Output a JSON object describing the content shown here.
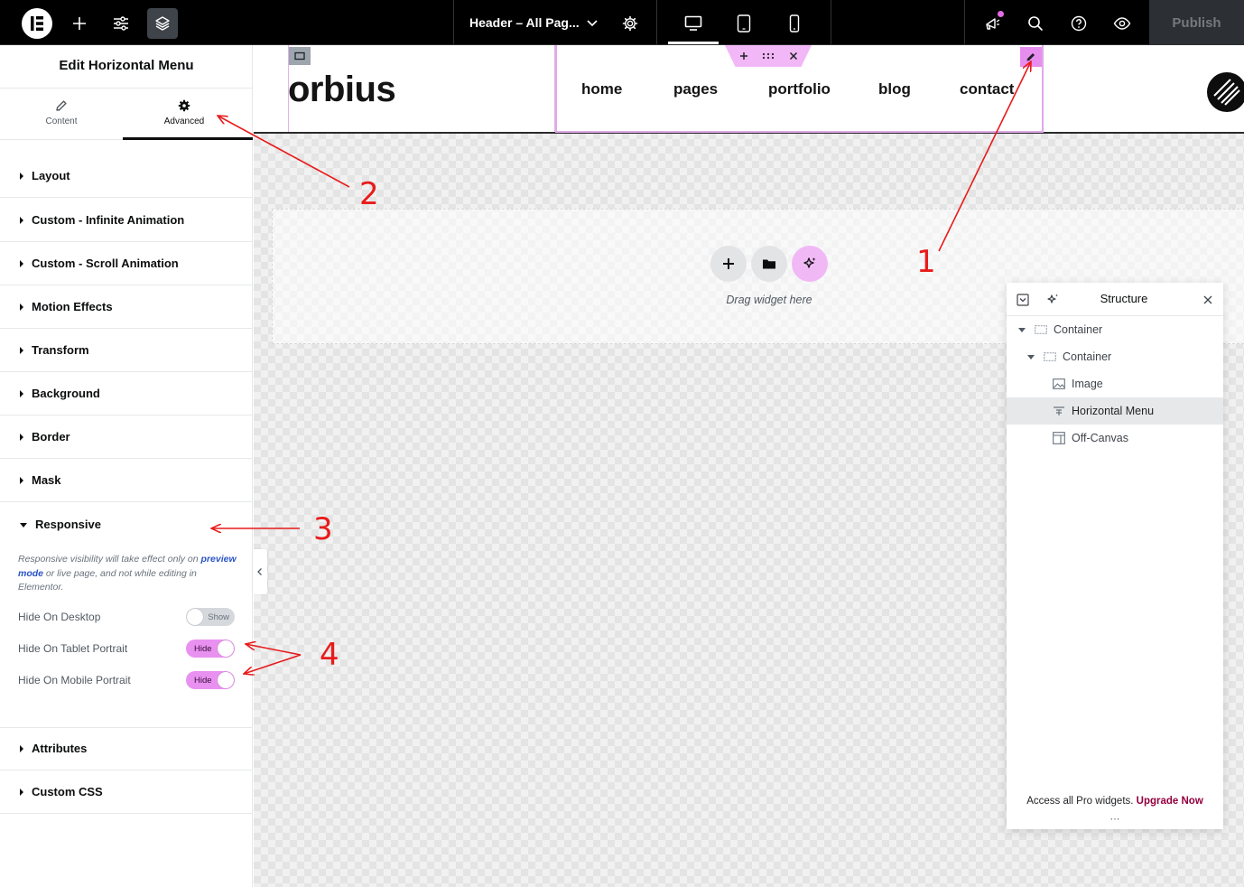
{
  "topbar": {
    "document_title": "Header – All Pag...",
    "publish_label": "Publish",
    "icons": [
      "elementor-logo-icon",
      "plus-icon",
      "sliders-icon",
      "layers-icon",
      "chevron-down-icon",
      "gear-icon",
      "desktop-icon",
      "tablet-icon",
      "mobile-icon",
      "megaphone-icon",
      "search-icon",
      "help-icon",
      "eye-icon"
    ]
  },
  "panel": {
    "title": "Edit Horizontal Menu",
    "tabs": [
      {
        "label": "Content",
        "icon": "pencil-icon"
      },
      {
        "label": "Advanced",
        "icon": "gear-icon",
        "active": true
      }
    ],
    "sections": [
      {
        "label": "Layout"
      },
      {
        "label": "Custom - Infinite Animation"
      },
      {
        "label": "Custom - Scroll Animation"
      },
      {
        "label": "Motion Effects"
      },
      {
        "label": "Transform"
      },
      {
        "label": "Background"
      },
      {
        "label": "Border"
      },
      {
        "label": "Mask"
      },
      {
        "label": "Responsive",
        "open": true
      },
      {
        "label": "Attributes"
      },
      {
        "label": "Custom CSS"
      }
    ],
    "responsive": {
      "note_before": "Responsive visibility will take effect only on ",
      "note_link": "preview mode",
      "note_after": " or live page, and not while editing in Elementor.",
      "controls": [
        {
          "label": "Hide On Desktop",
          "state": "Show",
          "on": false
        },
        {
          "label": "Hide On Tablet Portrait",
          "state": "Hide",
          "on": true
        },
        {
          "label": "Hide On Mobile Portrait",
          "state": "Hide",
          "on": true
        }
      ]
    }
  },
  "canvas": {
    "logo_text": "orbius",
    "menu_links": [
      "home",
      "pages",
      "portfolio",
      "blog",
      "contact"
    ],
    "drop_zone_text": "Drag widget here"
  },
  "structure": {
    "title": "Structure",
    "items": [
      {
        "label": "Container",
        "icon": "container-icon"
      },
      {
        "label": "Container",
        "icon": "container-icon"
      },
      {
        "label": "Image",
        "icon": "image-icon"
      },
      {
        "label": "Horizontal Menu",
        "icon": "menu-icon",
        "selected": true
      },
      {
        "label": "Off-Canvas",
        "icon": "off-canvas-icon"
      }
    ],
    "footer_text": "Access all Pro widgets. ",
    "footer_link": "Upgrade Now"
  },
  "annotations": [
    "1",
    "2",
    "3",
    "4"
  ],
  "colors": {
    "accent_pink": "#e991f0",
    "annotation_red": "#e81b1b",
    "upgrade_link": "#93003f"
  }
}
